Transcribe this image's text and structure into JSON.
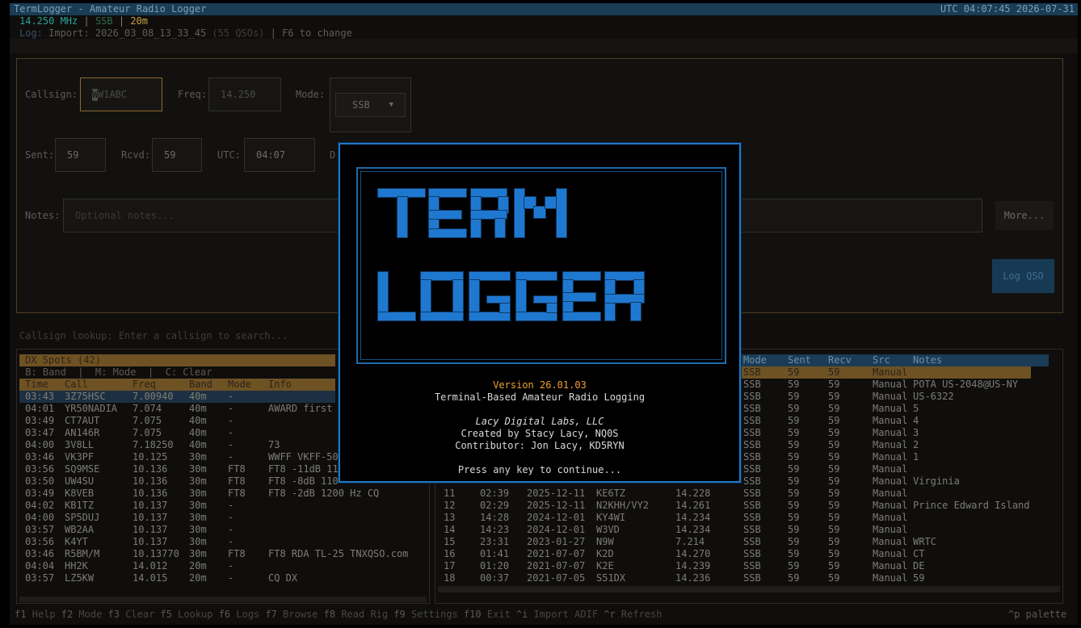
{
  "window": {
    "title": "TermLogger - Amateur Radio Logger",
    "clock": "UTC 04:07:45 2026-07-31"
  },
  "status": {
    "freq": "14.250 MHz",
    "sep": " | ",
    "mode": "SSB",
    "band": "20m"
  },
  "logline": {
    "label": "Log:",
    "text": " Import: 2026_03_08_13_33_45 ",
    "count": "(55 QSOs)",
    "hint": " | F6 to change"
  },
  "form": {
    "callsign_label": "Callsign:",
    "callsign_value": "W1ABC",
    "freq_label": "Freq:",
    "freq_value": "14.250",
    "mode_label": "Mode:",
    "mode_value": "SSB",
    "mode_arrow": "▼",
    "sent_label": "Sent:",
    "sent_value": "59",
    "rcvd_label": "Rcvd:",
    "rcvd_value": "59",
    "utc_label": "UTC:",
    "utc_value": "04:07",
    "date_label": "D",
    "notes_label": "Notes:",
    "notes_placeholder": "Optional notes...",
    "more_label": "More...",
    "log_label": "Log QSO"
  },
  "lookup": {
    "placeholder": "Callsign lookup: Enter a callsign to search..."
  },
  "spots": {
    "title": "DX Spots (42)",
    "hint": " B: Band  |  M: Mode  |  C: Clear",
    "columns": [
      "Time",
      "Call",
      "Freq",
      "Band",
      "Mode",
      "Info"
    ],
    "rows": [
      [
        "03:43",
        "3Z75HSC",
        "7.00940",
        "40m",
        "-",
        ""
      ],
      [
        "04:01",
        "YR50NADIA",
        "7.074",
        "40m",
        "-",
        "AWARD first"
      ],
      [
        "03:49",
        "CT7AUT",
        "7.075",
        "40m",
        "-",
        ""
      ],
      [
        "03:47",
        "AN146R",
        "7.075",
        "40m",
        "-",
        ""
      ],
      [
        "04:00",
        "3V8LL",
        "7.18250",
        "40m",
        "-",
        "73"
      ],
      [
        "03:46",
        "VK3PF",
        "10.125",
        "30m",
        "-",
        "WWFF VKFF-50"
      ],
      [
        "03:56",
        "SQ9MSE",
        "10.136",
        "30m",
        "FT8",
        "FT8 -11dB 11"
      ],
      [
        "03:50",
        "UW4SU",
        "10.136",
        "30m",
        "FT8",
        "FT8 -8dB 110"
      ],
      [
        "03:49",
        "K8VEB",
        "10.136",
        "30m",
        "FT8",
        "FT8 -2dB 1200 Hz CQ"
      ],
      [
        "04:02",
        "KB1TZ",
        "10.137",
        "30m",
        "-",
        ""
      ],
      [
        "04:00",
        "SP5DUJ",
        "10.137",
        "30m",
        "-",
        ""
      ],
      [
        "03:57",
        "WB2AA",
        "10.137",
        "30m",
        "-",
        ""
      ],
      [
        "03:56",
        "K4YT",
        "10.137",
        "30m",
        "-",
        ""
      ],
      [
        "03:46",
        "R5BM/M",
        "10.13770",
        "30m",
        "FT8",
        "FT8 RDA TL-25 TNXQSO.com"
      ],
      [
        "04:04",
        "HH2K",
        "14.012",
        "20m",
        "-",
        ""
      ],
      [
        "03:57",
        "LZ5KW",
        "14.015",
        "20m",
        "-",
        "CQ DX"
      ]
    ]
  },
  "qsos": {
    "columns": [
      "Mode",
      "Sent",
      "Recv",
      "Src",
      "Notes"
    ],
    "rows_right": [
      [
        "SSB",
        "59",
        "59",
        "Manual",
        ""
      ],
      [
        "SSB",
        "59",
        "59",
        "Manual",
        "POTA US-2048@US-NY"
      ],
      [
        "SSB",
        "59",
        "59",
        "Manual",
        "US-6322"
      ],
      [
        "SSB",
        "59",
        "59",
        "Manual",
        "5"
      ],
      [
        "SSB",
        "59",
        "59",
        "Manual",
        "4"
      ],
      [
        "SSB",
        "59",
        "59",
        "Manual",
        "3"
      ],
      [
        "SSB",
        "59",
        "59",
        "Manual",
        "2"
      ],
      [
        "SSB",
        "59",
        "59",
        "Manual",
        "1"
      ],
      [
        "SSB",
        "59",
        "59",
        "Manual",
        ""
      ],
      [
        "SSB",
        "59",
        "59",
        "Manual",
        "Virginia"
      ]
    ],
    "rows_full": [
      [
        "11",
        "02:39",
        "2025-12-11",
        "KE6TZ",
        "14.228",
        "SSB",
        "59",
        "59",
        "Manual",
        ""
      ],
      [
        "12",
        "02:29",
        "2025-12-11",
        "N2KHH/VY2",
        "14.261",
        "SSB",
        "59",
        "59",
        "Manual",
        "Prince Edward Island"
      ],
      [
        "13",
        "14:28",
        "2024-12-01",
        "KY4WI",
        "14.234",
        "SSB",
        "59",
        "59",
        "Manual",
        ""
      ],
      [
        "14",
        "14:23",
        "2024-12-01",
        "W3VD",
        "14.234",
        "SSB",
        "59",
        "59",
        "Manual",
        ""
      ],
      [
        "15",
        "23:31",
        "2023-01-27",
        "N9W",
        "7.214",
        "SSB",
        "59",
        "59",
        "Manual",
        "WRTC"
      ],
      [
        "16",
        "01:41",
        "2021-07-07",
        "K2D",
        "14.270",
        "SSB",
        "59",
        "59",
        "Manual",
        "CT"
      ],
      [
        "17",
        "01:20",
        "2021-07-07",
        "K2E",
        "14.239",
        "SSB",
        "59",
        "59",
        "Manual",
        "DE"
      ],
      [
        "18",
        "00:37",
        "2021-07-05",
        "S51DX",
        "14.236",
        "SSB",
        "59",
        "59",
        "Manual",
        "59"
      ]
    ]
  },
  "footer": {
    "keys": [
      [
        "f1",
        "Help"
      ],
      [
        "f2",
        "Mode"
      ],
      [
        "f3",
        "Clear"
      ],
      [
        "f5",
        "Lookup"
      ],
      [
        "f6",
        "Logs"
      ],
      [
        "f7",
        "Browse"
      ],
      [
        "f8",
        "Read Rig"
      ],
      [
        "f9",
        "Settings"
      ],
      [
        "f10",
        "Exit"
      ],
      [
        "^i",
        "Import ADIF"
      ],
      [
        "^r",
        "Refresh"
      ]
    ],
    "palette": "^p palette"
  },
  "splash": {
    "version": "Version 26.01.03",
    "tagline": "Terminal-Based Amateur Radio Logging",
    "company": "Lacy Digital Labs, LLC",
    "created": "Created by Stacy Lacy, NQ0S",
    "contrib": "Contributor: Jon Lacy, KD5RYN",
    "prompt": "Press any key to continue..."
  },
  "colors": {
    "accent": "#1f78d0",
    "status_freq": "#2aa198",
    "status_band": "#c8a23c",
    "version": "#f0a030",
    "spot_header": "#6e5224"
  }
}
